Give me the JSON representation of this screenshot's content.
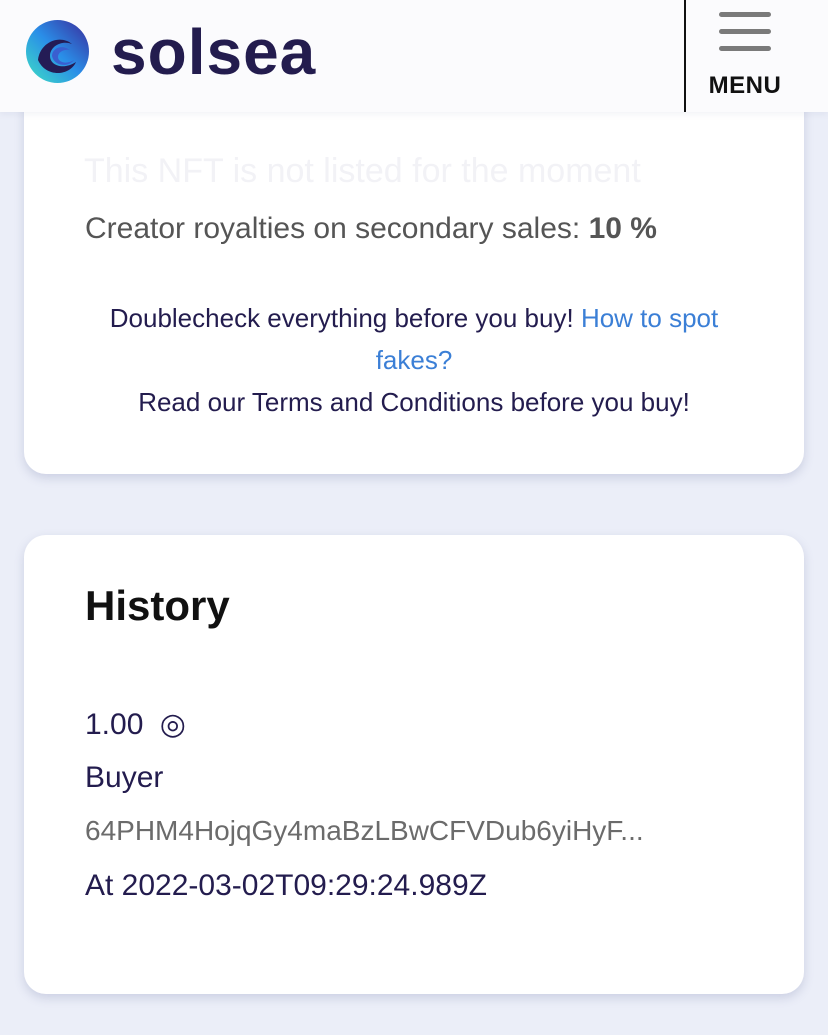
{
  "brand": {
    "name": "solsea",
    "logo_icon": "solsea-wave-icon"
  },
  "header": {
    "menu_label": "MENU",
    "menu_icon": "hamburger-icon"
  },
  "sale_info": {
    "faded_line": "This NFT is not listed for the moment",
    "royalties_label": "Creator royalties on secondary sales:",
    "royalties_value": "10 %",
    "notice_prefix": "Doublecheck everything before you buy!",
    "fakes_link": "How to spot fakes?",
    "terms_notice": "Read our Terms and Conditions before you buy!"
  },
  "history": {
    "title": "History",
    "entries": [
      {
        "price": "1.00",
        "currency_icon": "sol-coin-icon",
        "currency_glyph": "◎",
        "role": "Buyer",
        "address": "64PHM4HojqGy4maBzLBwCFVDub6yiHyF...",
        "date": "At 2022-03-02T09:29:24.989Z"
      }
    ]
  },
  "colors": {
    "brand_dark": "#231c4e",
    "link_blue": "#3b7fd6",
    "page_background": "#ebeef8"
  }
}
